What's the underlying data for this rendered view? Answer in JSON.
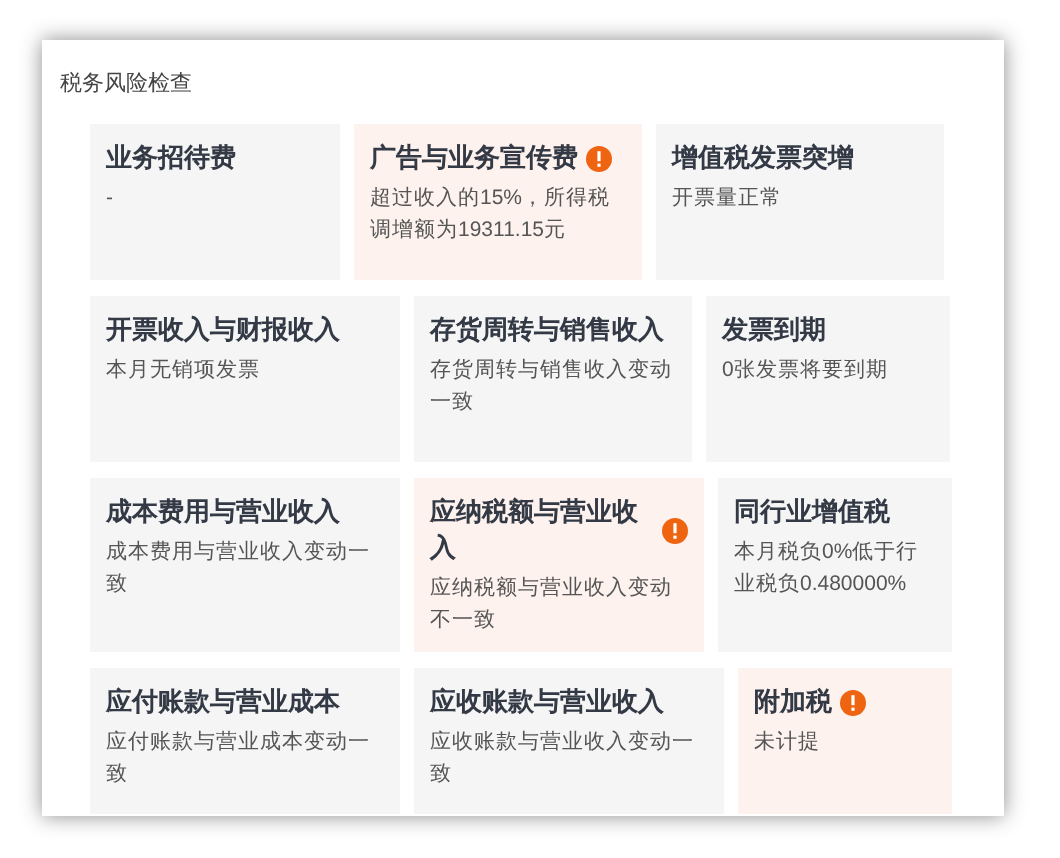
{
  "panel": {
    "title": "税务风险检查"
  },
  "rows": [
    {
      "cards": [
        {
          "title": "业务招待费",
          "description": "-",
          "warning": false
        },
        {
          "title": "广告与业务宣传费",
          "description": "超过收入的15%，所得税调增额为19311.15元",
          "warning": true
        },
        {
          "title": "增值税发票突增",
          "description": "开票量正常",
          "warning": false
        }
      ]
    },
    {
      "cards": [
        {
          "title": "开票收入与财报收入",
          "description": "本月无销项发票",
          "warning": false
        },
        {
          "title": "存货周转与销售收入",
          "description": "存货周转与销售收入变动一致",
          "warning": false
        },
        {
          "title": "发票到期",
          "description": "0张发票将要到期",
          "warning": false
        }
      ]
    },
    {
      "cards": [
        {
          "title": "成本费用与营业收入",
          "description": "成本费用与营业收入变动一致",
          "warning": false
        },
        {
          "title": "应纳税额与营业收入",
          "description": "应纳税额与营业收入变动不一致",
          "warning": true
        },
        {
          "title": "同行业增值税",
          "description": "本月税负0%低于行业税负0.480000%",
          "warning": false
        }
      ]
    },
    {
      "cards": [
        {
          "title": "应付账款与营业成本",
          "description": "应付账款与营业成本变动一致",
          "warning": false
        },
        {
          "title": "应收账款与营业收入",
          "description": "应收账款与营业收入变动一致",
          "warning": false
        },
        {
          "title": "附加税",
          "description": "未计提",
          "warning": true
        }
      ]
    }
  ]
}
